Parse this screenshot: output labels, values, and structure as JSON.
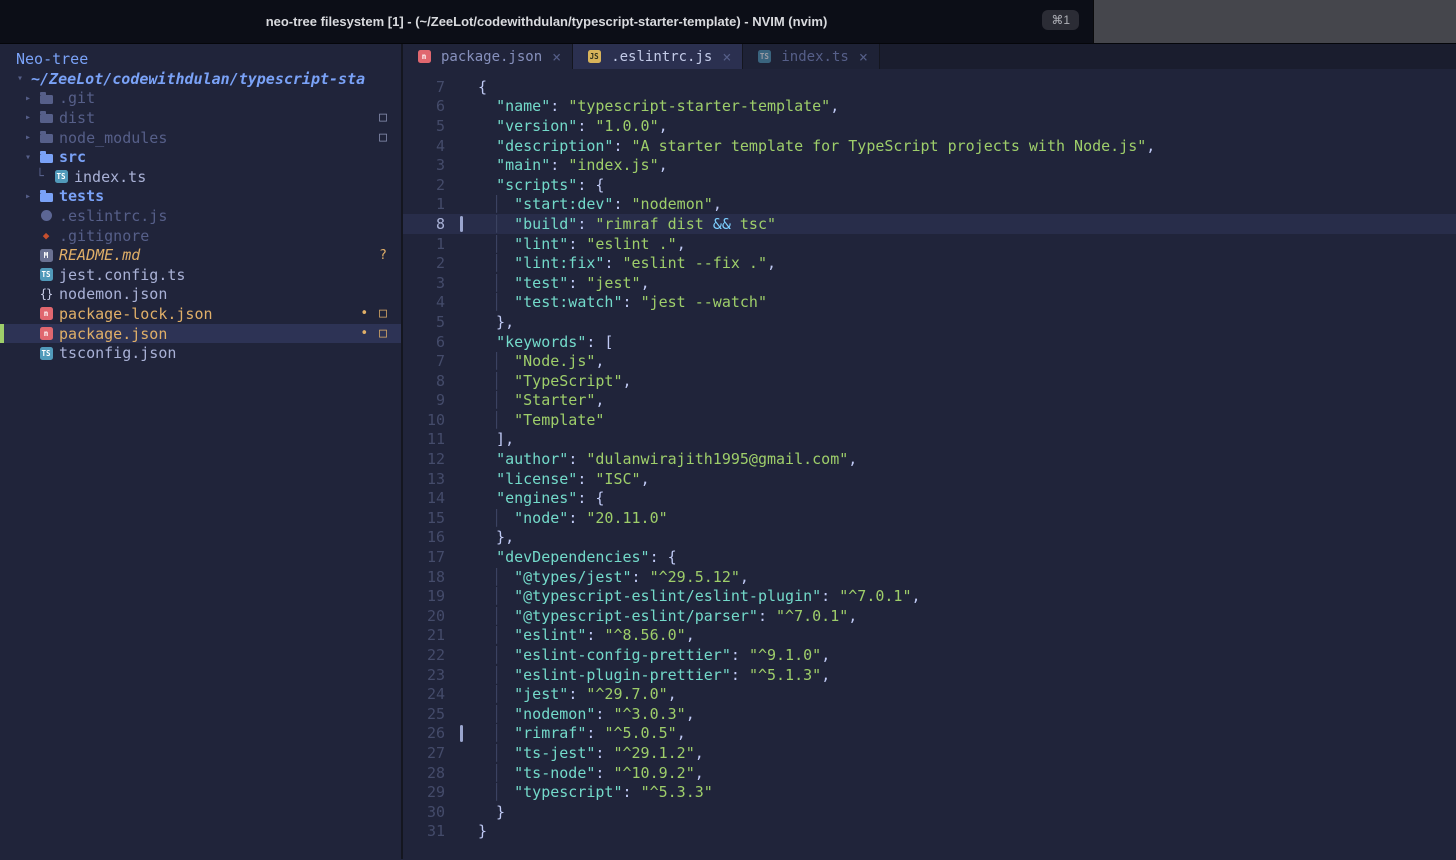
{
  "titlebar": {
    "title": "neo-tree filesystem [1] - (~/ZeeLot/codewithdulan/typescript-starter-template) - NVIM (nvim)",
    "shortcut": "⌘1"
  },
  "sidebar": {
    "header": "Neo-tree",
    "items": [
      {
        "label": "~/ZeeLot/codewithdulan/typescript-sta",
        "level": 0,
        "chevron": "down",
        "icon": null,
        "style": "root"
      },
      {
        "label": ".git",
        "level": 1,
        "chevron": "right",
        "icon": "folder",
        "style": "dim"
      },
      {
        "label": "dist",
        "level": 1,
        "chevron": "right",
        "icon": "folder",
        "style": "dim",
        "badges": [
          {
            "glyph": "□",
            "color": "grey",
            "name": "ignored"
          }
        ]
      },
      {
        "label": "node_modules",
        "level": 1,
        "chevron": "right",
        "icon": "folder",
        "style": "dim",
        "badges": [
          {
            "glyph": "□",
            "color": "grey",
            "name": "ignored"
          }
        ]
      },
      {
        "label": "src",
        "level": 1,
        "chevron": "down",
        "icon": "folder",
        "style": "folder-open"
      },
      {
        "label": "index.ts",
        "level": 2,
        "guide": true,
        "icon": "ts",
        "style": "file"
      },
      {
        "label": "tests",
        "level": 1,
        "chevron": "right",
        "icon": "folder",
        "style": "folder-open"
      },
      {
        "label": ".eslintrc.js",
        "level": 1,
        "icon": "eslint",
        "style": "dim"
      },
      {
        "label": ".gitignore",
        "level": 1,
        "icon": "git",
        "style": "dim"
      },
      {
        "label": "README.md",
        "level": 1,
        "icon": "markdown",
        "style": "modified italic",
        "badges": [
          {
            "glyph": "?",
            "color": "orange",
            "name": "untracked"
          }
        ]
      },
      {
        "label": "jest.config.ts",
        "level": 1,
        "icon": "ts",
        "style": "file"
      },
      {
        "label": "nodemon.json",
        "level": 1,
        "icon": "braces",
        "style": "file"
      },
      {
        "label": "package-lock.json",
        "level": 1,
        "icon": "npm",
        "style": "modified",
        "badges": [
          {
            "glyph": "•",
            "color": "orange",
            "name": "unstaged"
          },
          {
            "glyph": "□",
            "color": "orange",
            "name": "modified"
          }
        ]
      },
      {
        "label": "package.json",
        "level": 1,
        "icon": "npm",
        "style": "modified",
        "selected": true,
        "badges": [
          {
            "glyph": "•",
            "color": "orange",
            "name": "unstaged"
          },
          {
            "glyph": "□",
            "color": "orange",
            "name": "modified"
          }
        ]
      },
      {
        "label": "tsconfig.json",
        "level": 1,
        "icon": "ts",
        "style": "file"
      }
    ]
  },
  "editor": {
    "tabs": [
      {
        "label": "package.json",
        "icon": "npm",
        "close": "×",
        "state": "active"
      },
      {
        "label": ".eslintrc.js",
        "icon": "js",
        "close": "×",
        "state": "visible"
      },
      {
        "label": "index.ts",
        "icon": "ts",
        "close": "×",
        "state": "inactive"
      }
    ],
    "cursor_line": 8,
    "git_sign_lines": [
      8,
      34
    ],
    "gutter_numbers": [
      "7",
      "6",
      "5",
      "4",
      "3",
      "2",
      "1",
      "8",
      "1",
      "2",
      "3",
      "4",
      "5",
      "6",
      "7",
      "8",
      "9",
      "10",
      "11",
      "12",
      "13",
      "14",
      "15",
      "16",
      "17",
      "18",
      "19",
      "20",
      "21",
      "22",
      "23",
      "24",
      "25",
      "26",
      "27",
      "28",
      "29",
      "30",
      "31"
    ],
    "lines": [
      "{",
      "  \"name\": \"typescript-starter-template\",",
      "  \"version\": \"1.0.0\",",
      "  \"description\": \"A starter template for TypeScript projects with Node.js\",",
      "  \"main\": \"index.js\",",
      "  \"scripts\": {",
      "    \"start:dev\": \"nodemon\",",
      "    \"build\": \"rimraf dist && tsc\"",
      "    \"lint\": \"eslint .\",",
      "    \"lint:fix\": \"eslint --fix .\",",
      "    \"test\": \"jest\",",
      "    \"test:watch\": \"jest --watch\"",
      "  },",
      "  \"keywords\": [",
      "    \"Node.js\",",
      "    \"TypeScript\",",
      "    \"Starter\",",
      "    \"Template\"",
      "  ],",
      "  \"author\": \"dulanwirajith1995@gmail.com\",",
      "  \"license\": \"ISC\",",
      "  \"engines\": {",
      "    \"node\": \"20.11.0\"",
      "  },",
      "  \"devDependencies\": {",
      "    \"@types/jest\": \"^29.5.12\",",
      "    \"@typescript-eslint/eslint-plugin\": \"^7.0.1\",",
      "    \"@typescript-eslint/parser\": \"^7.0.1\",",
      "    \"eslint\": \"^8.56.0\",",
      "    \"eslint-config-prettier\": \"^9.1.0\",",
      "    \"eslint-plugin-prettier\": \"^5.1.3\",",
      "    \"jest\": \"^29.7.0\",",
      "    \"nodemon\": \"^3.0.3\",",
      "    \"rimraf\": \"^5.0.5\",",
      "    \"ts-jest\": \"^29.1.2\",",
      "    \"ts-node\": \"^10.9.2\",",
      "    \"typescript\": \"^5.3.3\"",
      "  }",
      "}"
    ]
  },
  "colors": {
    "accent_blue": "#7aa2f7",
    "json_key": "#73daca",
    "json_string": "#9ece6a",
    "operator_cyan": "#7dcfff",
    "modified_orange": "#e0af68",
    "npm_red": "#e0676f",
    "ts_blue": "#519aba",
    "selected_bar_green": "#9ece6a",
    "dim_grey": "#565f89"
  }
}
